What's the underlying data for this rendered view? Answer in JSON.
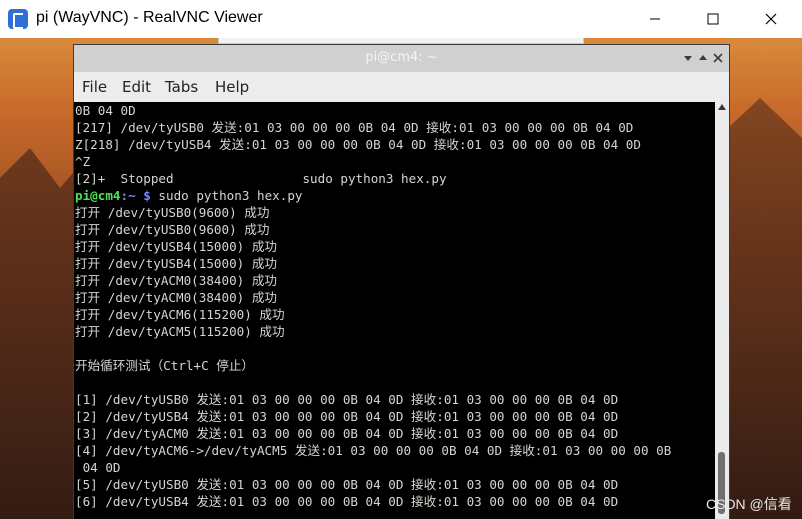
{
  "viewer": {
    "title": "pi (WayVNC) - RealVNC Viewer",
    "controls": {
      "minimize": "minimize",
      "maximize": "maximize",
      "close": "close"
    }
  },
  "terminal": {
    "title": "pi@cm4: ~",
    "menu": [
      "File",
      "Edit",
      "Tabs",
      "Help"
    ],
    "prompt_user": "pi@cm4",
    "prompt_path": ":~ $",
    "lines": [
      "0B 04 0D",
      "[217] /dev/tyUSB0 发送:01 03 00 00 00 0B 04 0D 接收:01 03 00 00 00 0B 04 0D",
      "Z[218] /dev/tyUSB4 发送:01 03 00 00 00 0B 04 0D 接收:01 03 00 00 00 0B 04 0D",
      "^Z",
      "[2]+  Stopped                 sudo python3 hex.py",
      " sudo python3 hex.py",
      "打开 /dev/tyUSB0(9600) 成功",
      "打开 /dev/tyUSB0(9600) 成功",
      "打开 /dev/tyUSB4(15000) 成功",
      "打开 /dev/tyUSB4(15000) 成功",
      "打开 /dev/tyACM0(38400) 成功",
      "打开 /dev/tyACM0(38400) 成功",
      "打开 /dev/tyACM6(115200) 成功",
      "打开 /dev/tyACM5(115200) 成功",
      "",
      "开始循环测试（Ctrl+C 停止）",
      "",
      "[1] /dev/tyUSB0 发送:01 03 00 00 00 0B 04 0D 接收:01 03 00 00 00 0B 04 0D",
      "[2] /dev/tyUSB4 发送:01 03 00 00 00 0B 04 0D 接收:01 03 00 00 00 0B 04 0D",
      "[3] /dev/tyACM0 发送:01 03 00 00 00 0B 04 0D 接收:01 03 00 00 00 0B 04 0D",
      "[4] /dev/tyACM6->/dev/tyACM5 发送:01 03 00 00 00 0B 04 0D 接收:01 03 00 00 00 0B",
      " 04 0D",
      "[5] /dev/tyUSB0 发送:01 03 00 00 00 0B 04 0D 接收:01 03 00 00 00 0B 04 0D",
      "[6] /dev/tyUSB4 发送:01 03 00 00 00 0B 04 0D 接收:01 03 00 00 00 0B 04 0D"
    ],
    "colors": {
      "background": "#000000",
      "text": "#d3d7cf",
      "prompt_user": "#4fe34f",
      "prompt_path": "#6f8cff"
    }
  },
  "watermark": "CSDN @信看"
}
